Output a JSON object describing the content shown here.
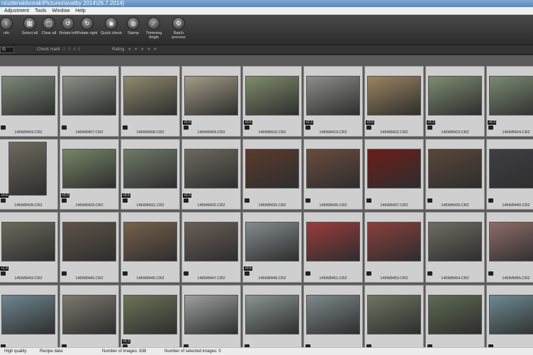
{
  "window": {
    "title": "rs\\zdenaldvorak\\Pictures\\svatby 2014\\26.7.2014]"
  },
  "menu": [
    "Adjustment",
    "Tools",
    "Window",
    "Help"
  ],
  "toolbar": [
    {
      "label": "nfo",
      "icon": "info-icon",
      "glyph": "i"
    },
    {
      "label": "Select all",
      "icon": "select-all-icon",
      "glyph": "▦"
    },
    {
      "label": "Clear all",
      "icon": "clear-all-icon",
      "glyph": "▢"
    },
    {
      "label": "Rotate left",
      "icon": "rotate-left-icon",
      "glyph": "↺"
    },
    {
      "label": "Rotate right",
      "icon": "rotate-right-icon",
      "glyph": "↻"
    },
    {
      "label": "Quick check",
      "icon": "quick-check-icon",
      "glyph": "◉"
    },
    {
      "label": "Stamp",
      "icon": "stamp-icon",
      "glyph": "◍"
    },
    {
      "label": "Trimming Angle",
      "icon": "trimming-angle-icon",
      "glyph": "⟋"
    },
    {
      "label": "Batch process",
      "icon": "batch-process-icon",
      "glyph": "⚙"
    }
  ],
  "filter": {
    "count": "0)",
    "check_mark_label": "Check mark",
    "check_marks": "1 2 3 4 5",
    "rating_label": "Rating",
    "rating_stars": "★ ★ ★ ★ ★"
  },
  "rows": [
    [
      {
        "name": "146W8404.CR2",
        "ev": "",
        "color": "#7d8a7a"
      },
      {
        "name": "146W8407.CR2",
        "ev": "",
        "color": "#8a9186"
      },
      {
        "name": "146W8408.CR2",
        "ev": "",
        "color": "#8f8a6f"
      },
      {
        "name": "146W8409.CR2",
        "ev": "+0.3",
        "color": "#a39c86"
      },
      {
        "name": "146W8416.CR2",
        "ev": "+0.6",
        "color": "#7f8c6b"
      },
      {
        "name": "146W8419.CR2",
        "ev": "+0.3",
        "color": "#8d8d8a"
      },
      {
        "name": "146W8422.CR2",
        "ev": "+0.6",
        "color": "#9c8460"
      },
      {
        "name": "146W8423.CR2",
        "ev": "+0.3",
        "color": "#7e8d70"
      },
      {
        "name": "146W8424.CR2",
        "ev": "+0.3",
        "color": "#7a8a72"
      }
    ],
    [
      {
        "name": "146W8428.CR2",
        "ev": "+0.6",
        "color": "#6f6a5e",
        "portrait": true
      },
      {
        "name": "146W8429.CR2",
        "ev": "+0.3",
        "color": "#768666"
      },
      {
        "name": "146W8431.CR2",
        "ev": "+0.6",
        "color": "#6f7a68"
      },
      {
        "name": "146W8432.CR2",
        "ev": "+0.3",
        "color": "#6b6a5e"
      },
      {
        "name": "146W8435.CR2",
        "ev": "",
        "color": "#5b3a2d"
      },
      {
        "name": "146W8436.CR2",
        "ev": "",
        "color": "#6a4b3c"
      },
      {
        "name": "146W8437.CR2",
        "ev": "",
        "color": "#6b1d1a"
      },
      {
        "name": "146W8439.CR2",
        "ev": "",
        "color": "#5a4638"
      },
      {
        "name": "146W8440.CR2",
        "ev": "",
        "color": "#3f3f44"
      }
    ],
    [
      {
        "name": "146W8443.CR2",
        "ev": "+1.0",
        "color": "#6a6a5c"
      },
      {
        "name": "146W8445.CR2",
        "ev": "",
        "color": "#5e5448"
      },
      {
        "name": "146W8446.CR2",
        "ev": "",
        "color": "#77614b"
      },
      {
        "name": "146W8447.CR2",
        "ev": "",
        "color": "#6a5f58"
      },
      {
        "name": "146W8448.CR2",
        "ev": "+0.6",
        "color": "#858c8c"
      },
      {
        "name": "146W8451.CR2",
        "ev": "",
        "color": "#9b3b3b"
      },
      {
        "name": "146W8453.CR2",
        "ev": "",
        "color": "#8a3f3c"
      },
      {
        "name": "146W8454.CR2",
        "ev": "",
        "color": "#6f6c62"
      },
      {
        "name": "146W8455.CR2",
        "ev": "",
        "color": "#8d6c68"
      }
    ],
    [
      {
        "name": "146W8461.CR2",
        "ev": "",
        "color": "#6e8791"
      },
      {
        "name": "146W8462.CR2",
        "ev": "",
        "color": "#7b7a6f"
      },
      {
        "name": "146W8468.CR2",
        "ev": "+0.3",
        "color": "#6c7456"
      },
      {
        "name": "146W8469.CR2",
        "ev": "",
        "color": "#9ea0a0"
      },
      {
        "name": "146W8470.CR2",
        "ev": "",
        "color": "#8a9591"
      },
      {
        "name": "146W8475.CR2",
        "ev": "",
        "color": "#7f8a8c"
      },
      {
        "name": "146W8476.CR2",
        "ev": "",
        "color": "#6d7660"
      },
      {
        "name": "146W8477.CR2",
        "ev": "",
        "color": "#5e6b52"
      },
      {
        "name": "146W8478.CR2",
        "ev": "",
        "color": "#6d8a92"
      }
    ]
  ],
  "status": {
    "quality": "High quality",
    "recipe": "Recipe data:",
    "images": "Number of images: 638",
    "selected": "Number of selected images: 0"
  }
}
